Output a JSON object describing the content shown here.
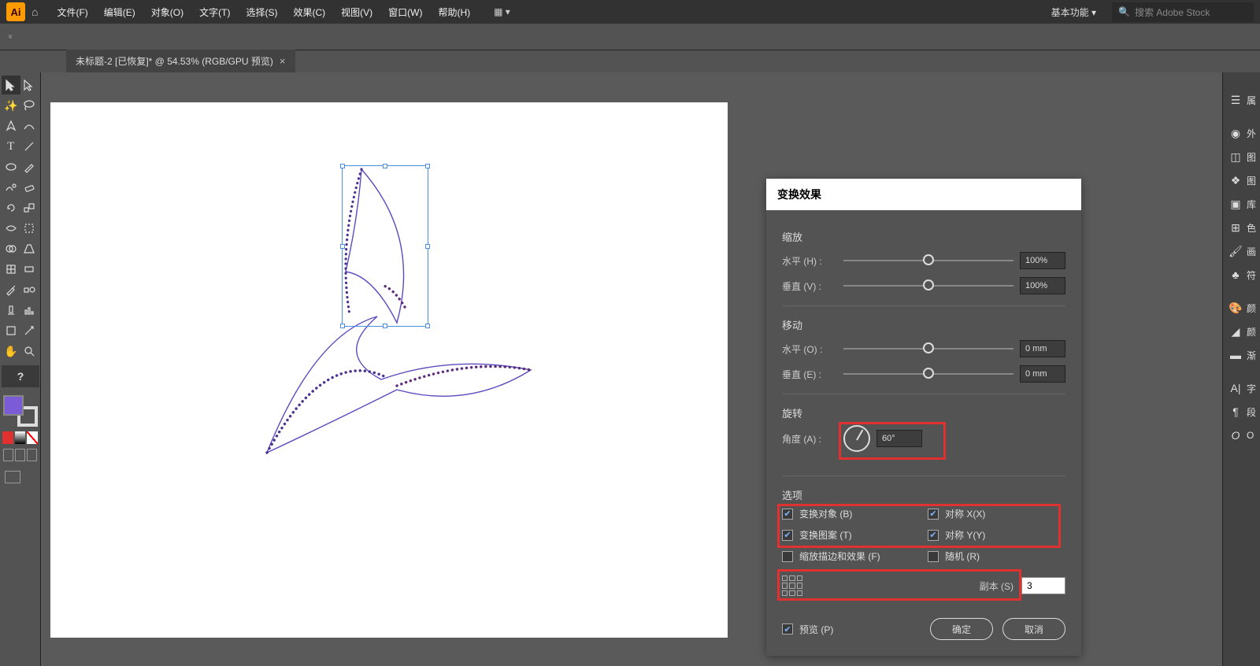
{
  "app": {
    "logo": "Ai"
  },
  "menu": {
    "items": [
      "文件(F)",
      "编辑(E)",
      "对象(O)",
      "文字(T)",
      "选择(S)",
      "效果(C)",
      "视图(V)",
      "窗口(W)",
      "帮助(H)"
    ],
    "workspace_label": "基本功能",
    "stock_placeholder": "搜索 Adobe Stock"
  },
  "tab": {
    "title": "未标题-2 [已恢复]* @ 54.53% (RGB/GPU 预览)",
    "close": "×"
  },
  "dialog": {
    "title": "变换效果",
    "scale": {
      "label": "缩放",
      "h_label": "水平 (H) :",
      "v_label": "垂直 (V) :",
      "h_val": "100%",
      "v_val": "100%"
    },
    "move": {
      "label": "移动",
      "h_label": "水平 (O) :",
      "v_label": "垂直 (E) :",
      "h_val": "0 mm",
      "v_val": "0 mm"
    },
    "rotate": {
      "label": "旋转",
      "angle_label": "角度 (A) :",
      "angle_val": "60°"
    },
    "options": {
      "label": "选项",
      "transform_obj": "变换对象 (B)",
      "reflect_x": "对称 X(X)",
      "transform_pat": "变换图案 (T)",
      "reflect_y": "对称 Y(Y)",
      "scale_strokes": "缩放描边和效果 (F)",
      "random": "随机 (R)"
    },
    "copies": {
      "label": "副本 (S)",
      "value": "3"
    },
    "preview": "预览 (P)",
    "ok": "确定",
    "cancel": "取消"
  },
  "right_panels": {
    "p0": "属",
    "p1": "外",
    "p2": "图",
    "p3": "图",
    "p4": "库",
    "p5": "色",
    "p6": "画",
    "p7": "符",
    "p8": "颜",
    "p9": "颜",
    "p10": "渐",
    "p11": "字",
    "p12": "段",
    "p13": "O"
  }
}
